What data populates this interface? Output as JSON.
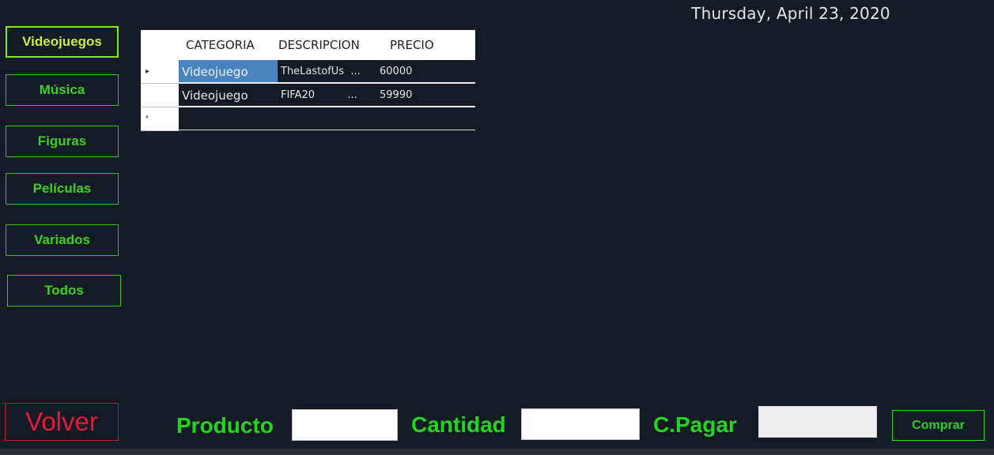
{
  "header": {
    "date": "Thursday, April 23, 2020"
  },
  "categories": [
    {
      "label": "Videojuegos",
      "active": true
    },
    {
      "label": "Música",
      "active": false
    },
    {
      "label": "Figuras",
      "active": false
    },
    {
      "label": "Películas",
      "active": false
    },
    {
      "label": "Variados",
      "active": false
    },
    {
      "label": "Todos",
      "active": false
    }
  ],
  "grid": {
    "columns": [
      "CATEGORIA",
      "DESCRIPCION",
      "PRECIO"
    ],
    "rows": [
      {
        "marker": "▸",
        "categoria": "Videojuego",
        "descripcion": "TheLastofUs  ...",
        "precio": "60000"
      },
      {
        "marker": "",
        "categoria": "Videojuego",
        "descripcion": "FIFA20          ...",
        "precio": "59990"
      },
      {
        "marker": "*",
        "categoria": "",
        "descripcion": "",
        "precio": ""
      }
    ]
  },
  "footer": {
    "back_label": "Volver",
    "producto_label": "Producto",
    "cantidad_label": "Cantidad",
    "pagar_label": "C.Pagar",
    "producto_value": "",
    "cantidad_value": "",
    "pagar_value": "",
    "buy_label": "Comprar"
  }
}
